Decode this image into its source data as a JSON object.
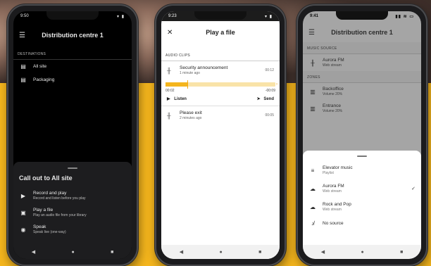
{
  "phone1": {
    "time": "9:50",
    "signal": "▾ ▮",
    "title": "Distribution centre 1",
    "section": "DESTINATIONS",
    "destinations": [
      {
        "label": "All site"
      },
      {
        "label": "Packaging"
      }
    ],
    "sheet": {
      "title": "Call out to All site",
      "options": [
        {
          "title": "Record and play",
          "subtitle": "Record and listen before you play"
        },
        {
          "title": "Play a file",
          "subtitle": "Play an audio file from your library"
        },
        {
          "title": "Speak",
          "subtitle": "Speak live (one-way)"
        }
      ]
    }
  },
  "phone2": {
    "time": "9:23",
    "signal": "▾ ▮",
    "title": "Play a file",
    "section": "AUDIO CLIPS",
    "clips": [
      {
        "title": "Security announcement",
        "subtitle": "1 minute ago",
        "duration": "00:12"
      },
      {
        "title": "Please exit",
        "subtitle": "2 minutes ago",
        "duration": "00:05"
      }
    ],
    "player": {
      "elapsed": "00:02",
      "remaining": "-00:09",
      "progress": 0.2,
      "listen_label": "Listen",
      "send_label": "Send"
    }
  },
  "phone3": {
    "time": "9:41",
    "title": "Distribution centre 1",
    "music_section": "MUSIC SOURCE",
    "music_source": {
      "title": "Aurora FM",
      "subtitle": "Web stream"
    },
    "zones_section": "ZONES",
    "zones": [
      {
        "title": "Backoffice",
        "subtitle": "Volume 20%"
      },
      {
        "title": "Entrance",
        "subtitle": "Volume 20%"
      }
    ],
    "sources": [
      {
        "title": "Elevator music",
        "subtitle": "Playlist",
        "selected": false
      },
      {
        "title": "Aurora FM",
        "subtitle": "Web stream",
        "selected": true
      },
      {
        "title": "Rock and Pop",
        "subtitle": "Web stream",
        "selected": false
      },
      {
        "title": "No source",
        "subtitle": "",
        "selected": false
      }
    ]
  },
  "colors": {
    "accent": "#f4b51d",
    "background_yellow": "#f4b51d"
  }
}
